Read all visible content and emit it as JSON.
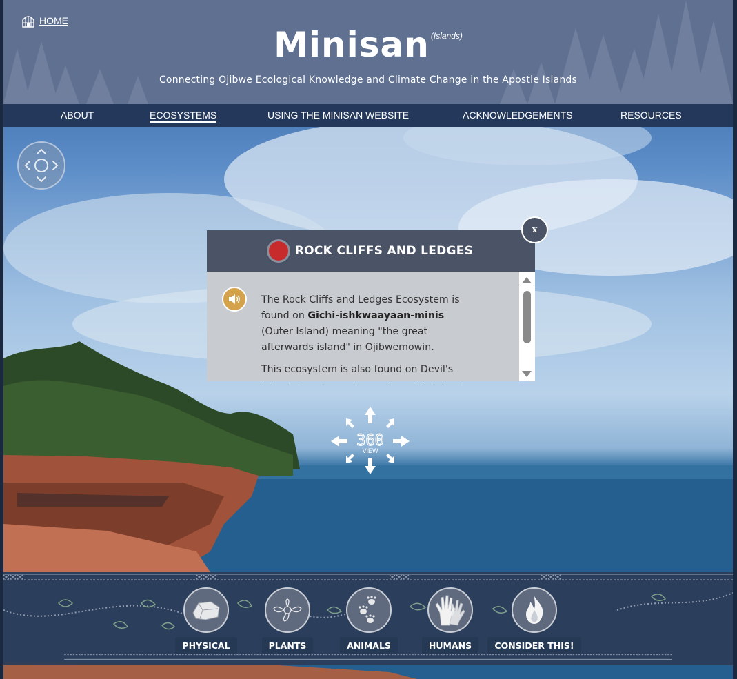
{
  "header": {
    "home_label": "HOME",
    "title": "Minisan",
    "title_suffix": "(Islands)",
    "tagline": "Connecting Ojibwe Ecological Knowledge and Climate Change in the Apostle Islands"
  },
  "nav": {
    "items": [
      {
        "label": "ABOUT"
      },
      {
        "label": "ECOSYSTEMS",
        "active": true
      },
      {
        "label": "USING THE MINISAN WEBSITE"
      },
      {
        "label": "ACKNOWLEDGEMENTS"
      },
      {
        "label": "RESOURCES"
      }
    ]
  },
  "popup": {
    "title": "ROCK CLIFFS AND LEDGES",
    "close_label": "x",
    "para1_a": "The Rock Cliffs and Ledges Ecosystem is found on ",
    "para1_bold": "Gichi-ishkwaayaan-minis",
    "para1_b": " (Outer Island) meaning \"the great afterwards island\" in Ojibwemowin.",
    "para2": "This ecosystem is also found on Devil's Island. See the rock, weathered, brink of the",
    "dot_color": "#c72b2b"
  },
  "view360": {
    "number": "360",
    "label": "VIEW"
  },
  "categories": [
    {
      "label": "PHYSICAL",
      "icon": "rock-icon"
    },
    {
      "label": "PLANTS",
      "icon": "plant-beadwork-icon"
    },
    {
      "label": "ANIMALS",
      "icon": "paw-prints-icon"
    },
    {
      "label": "HUMANS",
      "icon": "hands-icon"
    },
    {
      "label": "CONSIDER THIS!",
      "icon": "fire-icon"
    }
  ]
}
